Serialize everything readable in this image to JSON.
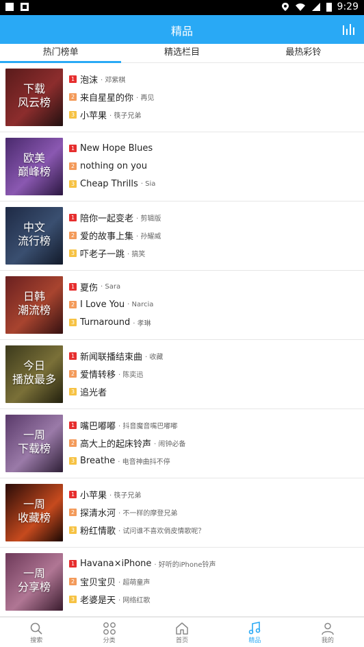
{
  "status": {
    "time": "9:29"
  },
  "header": {
    "title": "精品"
  },
  "tabs": [
    "热门榜单",
    "精选栏目",
    "最热彩铃"
  ],
  "charts": [
    {
      "label": "下载\n风云榜",
      "songs": [
        {
          "rank": "1",
          "title": "泡沫",
          "artist": "· 邓紫棋"
        },
        {
          "rank": "2",
          "title": "来自星星的你",
          "artist": "· 再见"
        },
        {
          "rank": "3",
          "title": "小苹果",
          "artist": "· 筷子兄弟"
        }
      ]
    },
    {
      "label": "欧美\n巅峰榜",
      "songs": [
        {
          "rank": "1",
          "title": "New Hope Blues",
          "artist": ""
        },
        {
          "rank": "2",
          "title": "nothing on you",
          "artist": ""
        },
        {
          "rank": "3",
          "title": "Cheap Thrills",
          "artist": "· Sia"
        }
      ]
    },
    {
      "label": "中文\n流行榜",
      "songs": [
        {
          "rank": "1",
          "title": "陪你一起变老",
          "artist": "· 剪辑版"
        },
        {
          "rank": "2",
          "title": "爱的故事上集",
          "artist": "· 孙耀威"
        },
        {
          "rank": "3",
          "title": "吓老子一跳",
          "artist": "· 搞笑"
        }
      ]
    },
    {
      "label": "日韩\n潮流榜",
      "songs": [
        {
          "rank": "1",
          "title": "夏伤",
          "artist": "· Sara"
        },
        {
          "rank": "2",
          "title": "I Love You",
          "artist": "· Narcia"
        },
        {
          "rank": "3",
          "title": "Turnaround",
          "artist": "· 孝琳"
        }
      ]
    },
    {
      "label": "今日\n播放最多",
      "songs": [
        {
          "rank": "1",
          "title": "新闻联播结束曲",
          "artist": "· 收藏"
        },
        {
          "rank": "2",
          "title": "爱情转移",
          "artist": "· 陈奕迅"
        },
        {
          "rank": "3",
          "title": "追光者",
          "artist": ""
        }
      ]
    },
    {
      "label": "一周\n下载榜",
      "songs": [
        {
          "rank": "1",
          "title": "嘴巴嘟嘟",
          "artist": "· 抖音魔音嘴巴嘟嘟"
        },
        {
          "rank": "2",
          "title": "高大上的起床铃声",
          "artist": "· 闹钟必备"
        },
        {
          "rank": "3",
          "title": "Breathe",
          "artist": "· 电音神曲抖不停"
        }
      ]
    },
    {
      "label": "一周\n收藏榜",
      "songs": [
        {
          "rank": "1",
          "title": "小苹果",
          "artist": "· 筷子兄弟"
        },
        {
          "rank": "2",
          "title": "探清水河",
          "artist": "· 不一样的摩登兄弟"
        },
        {
          "rank": "3",
          "title": "粉红情歌",
          "artist": "· 试问谁不喜欢俏皮情歌呢？"
        }
      ]
    },
    {
      "label": "一周\n分享榜",
      "songs": [
        {
          "rank": "1",
          "title": "Havana×iPhone",
          "artist": "· 好听的iPhone铃声"
        },
        {
          "rank": "2",
          "title": "宝贝宝贝",
          "artist": "· 超萌童声"
        },
        {
          "rank": "3",
          "title": "老婆是天",
          "artist": "· 网络红歌"
        }
      ]
    }
  ],
  "bottom_nav": [
    {
      "label": "搜索",
      "icon": "search-icon"
    },
    {
      "label": "分类",
      "icon": "category-icon"
    },
    {
      "label": "首页",
      "icon": "home-icon"
    },
    {
      "label": "精品",
      "icon": "music-note-icon",
      "active": true
    },
    {
      "label": "我的",
      "icon": "user-icon"
    }
  ],
  "colors": {
    "accent": "#29A9F5",
    "rank1": "#E62E2E",
    "rank2": "#F39A5A",
    "rank3": "#F6C243"
  }
}
